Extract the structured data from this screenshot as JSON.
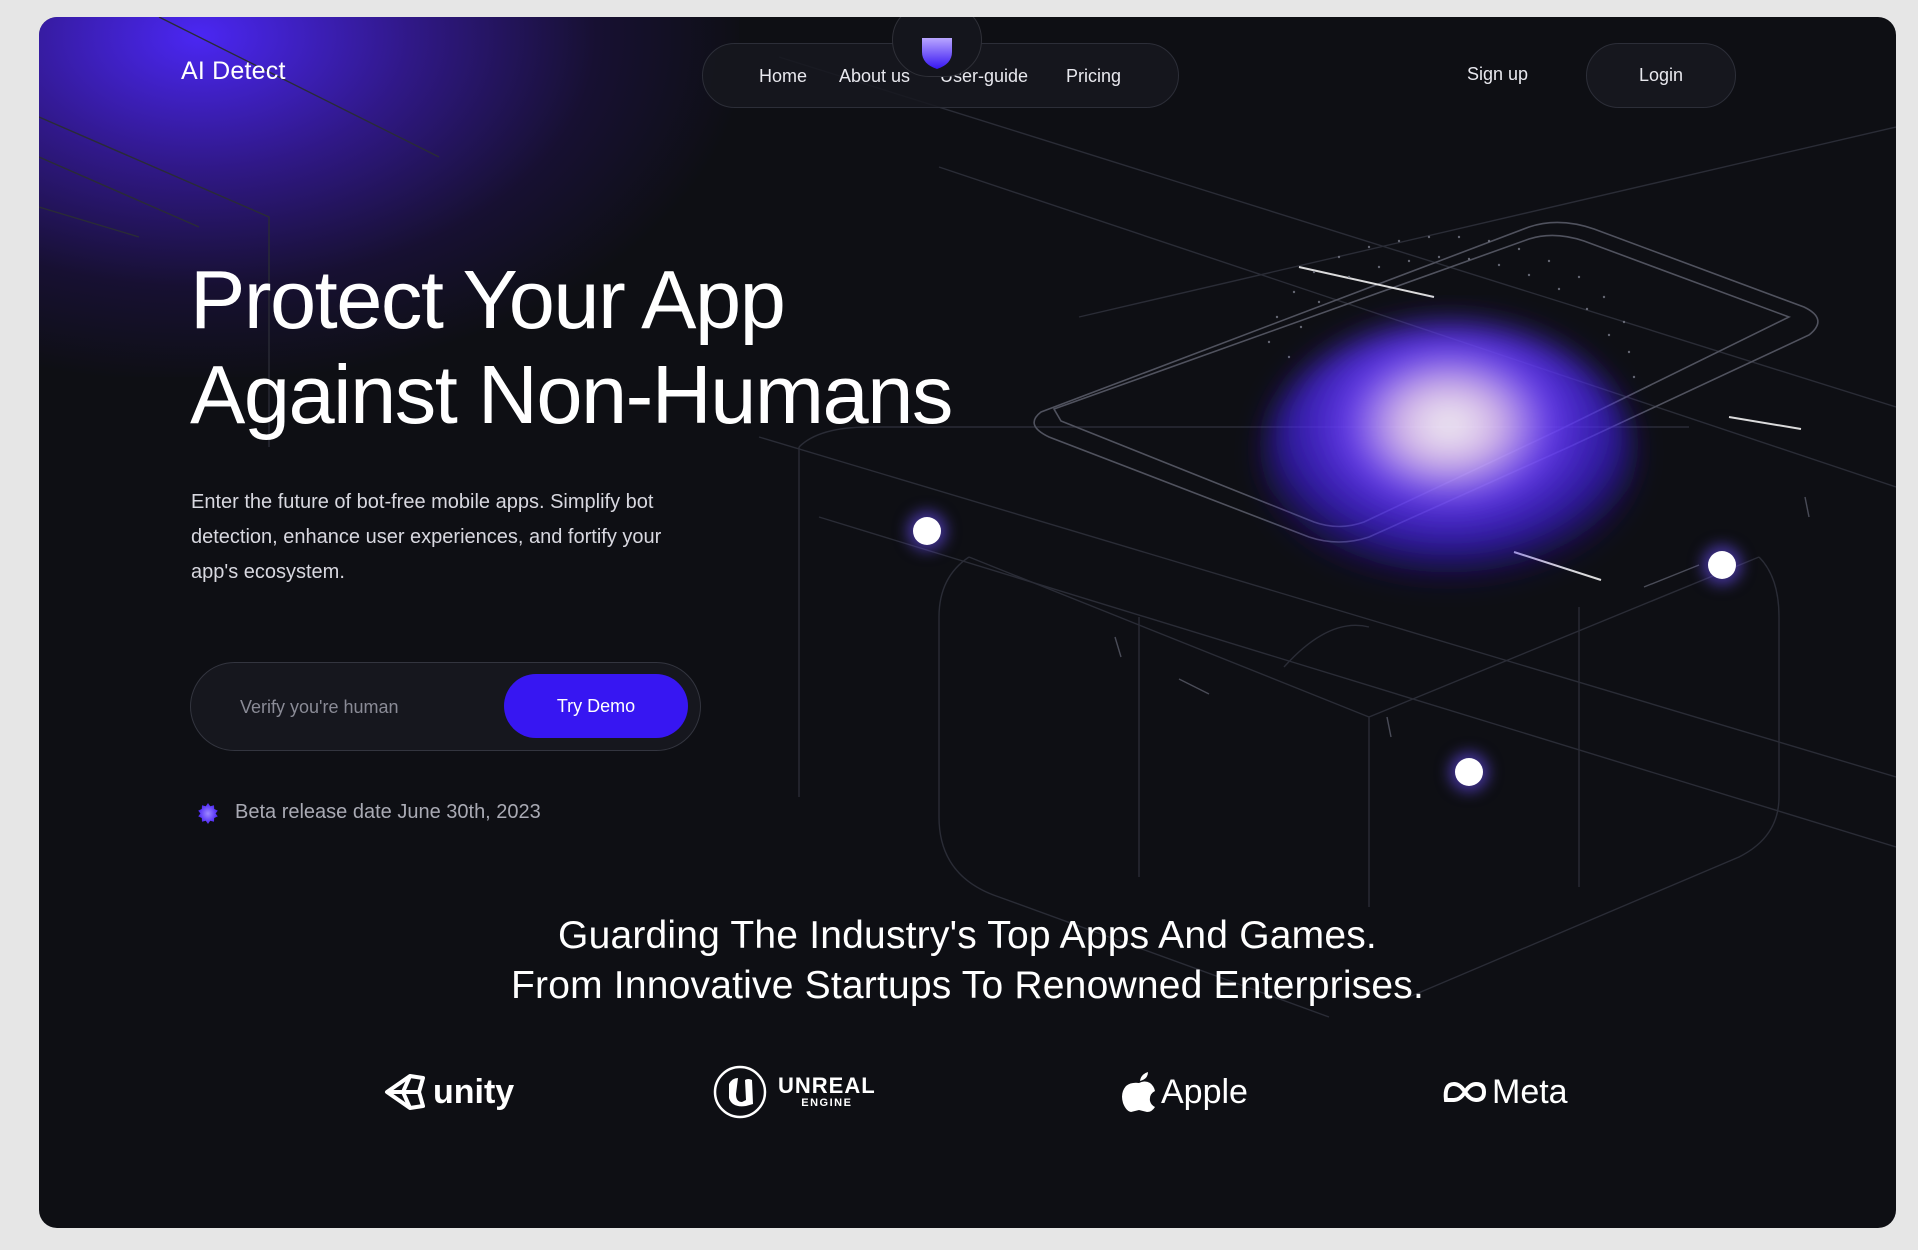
{
  "app": {
    "title": "AI Detect"
  },
  "nav": {
    "items": [
      {
        "label": "Home"
      },
      {
        "label": "About us"
      },
      {
        "label": "User-guide"
      },
      {
        "label": "Pricing"
      }
    ],
    "active_icon": "shield-icon"
  },
  "header": {
    "signup_label": "Sign up",
    "login_label": "Login"
  },
  "hero": {
    "title_line1": "Protect Your App",
    "title_line2": "Against Non-Humans",
    "subtitle_line1": "Enter the future of bot-free mobile apps. Simplify bot",
    "subtitle_line2": "detection, enhance user experiences, and fortify your",
    "subtitle_line3": "app's ecosystem.",
    "verify_placeholder": "Verify you're human",
    "verify_value": "",
    "demo_label": "Try Demo",
    "beta_text": "Beta release date June 30th, 2023"
  },
  "partners": {
    "heading_line1": "Guarding The Industry's Top Apps And Games.",
    "heading_line2": "From Innovative Startups To Renowned Enterprises.",
    "logos": [
      {
        "name": "unity",
        "icon": "unity-logo-icon"
      },
      {
        "name": "UNREAL",
        "sub": "ENGINE",
        "icon": "unreal-logo-icon"
      },
      {
        "name": "Apple",
        "icon": "apple-logo-icon"
      },
      {
        "name": "Meta",
        "icon": "meta-logo-icon"
      }
    ]
  },
  "colors": {
    "background": "#0e0f14",
    "accent": "#3716f2",
    "glow": "#4e28ff",
    "outer": "#e6e6e6"
  }
}
